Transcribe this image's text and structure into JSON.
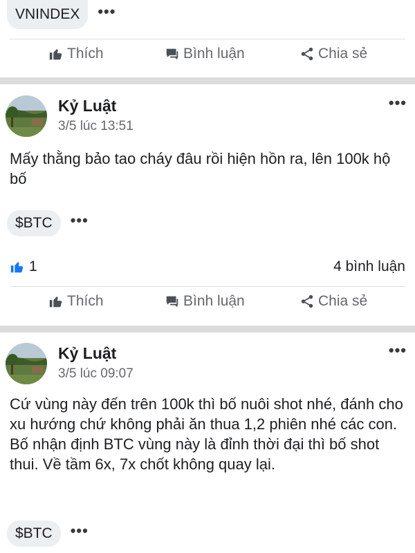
{
  "top_post": {
    "tag": "VNINDEX",
    "actions": {
      "like": "Thích",
      "comment": "Bình luận",
      "share": "Chia sẻ"
    }
  },
  "post1": {
    "author": "Kỷ Luật",
    "time": "3/5 lúc 13:51",
    "text": "Mấy thằng bảo tao cháy đâu rồi hiện hồn ra, lên 100k hộ bố",
    "tag": "$BTC",
    "likes": "1",
    "comments": "4 bình luận",
    "actions": {
      "like": "Thích",
      "comment": "Bình luận",
      "share": "Chia sẻ"
    }
  },
  "post2": {
    "author": "Kỷ Luật",
    "time": "3/5 lúc 09:07",
    "text": "Cứ vùng này đến trên 100k thì bố nuôi shot nhé, đánh cho xu hướng chứ không phải ăn thua 1,2 phiên nhé các con. Bố nhận định BTC vùng này là đỉnh thời đại thì bố shot thui. Về tầm 6x, 7x chốt không quay lại.",
    "tag": "$BTC"
  },
  "colors": {
    "like_blue": "#1877f2",
    "muted_text": "#65676b",
    "chip_bg": "#eceff2",
    "separator": "#dcdcdc"
  },
  "icons": [
    "thumbs-up-icon",
    "comment-icon",
    "share-icon",
    "more-icon",
    "like-reaction-icon"
  ]
}
